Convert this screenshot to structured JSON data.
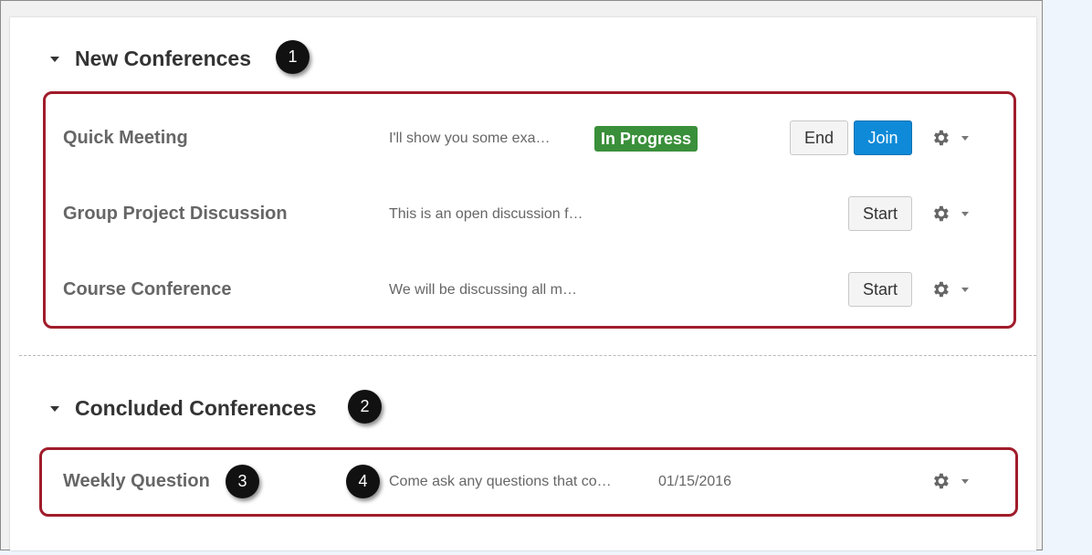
{
  "sections": [
    {
      "title": "New Conferences",
      "callout": "1",
      "rows": [
        {
          "title": "Quick Meeting",
          "description": "I'll show you some exa…",
          "status_badge": "In Progress",
          "actions": [
            "End",
            "Join"
          ]
        },
        {
          "title": "Group Project Discussion",
          "description": "This is an open discussion f…",
          "actions": [
            "Start"
          ]
        },
        {
          "title": "Course Conference",
          "description": "We will be discussing all m…",
          "actions": [
            "Start"
          ]
        }
      ]
    },
    {
      "title": "Concluded Conferences",
      "callout": "2",
      "rows": [
        {
          "title": "Weekly Question",
          "description": "Come ask any questions that co…",
          "date": "01/15/2016",
          "title_callout": "3",
          "description_callout": "4"
        }
      ]
    }
  ],
  "icons": {
    "section_toggle": "caret-down-icon",
    "settings": "gear-icon",
    "settings_menu": "chevron-down-icon"
  },
  "colors": {
    "highlight": "#a01c2b",
    "badge": "#3a8f3a",
    "primary": "#0e8ad8"
  }
}
